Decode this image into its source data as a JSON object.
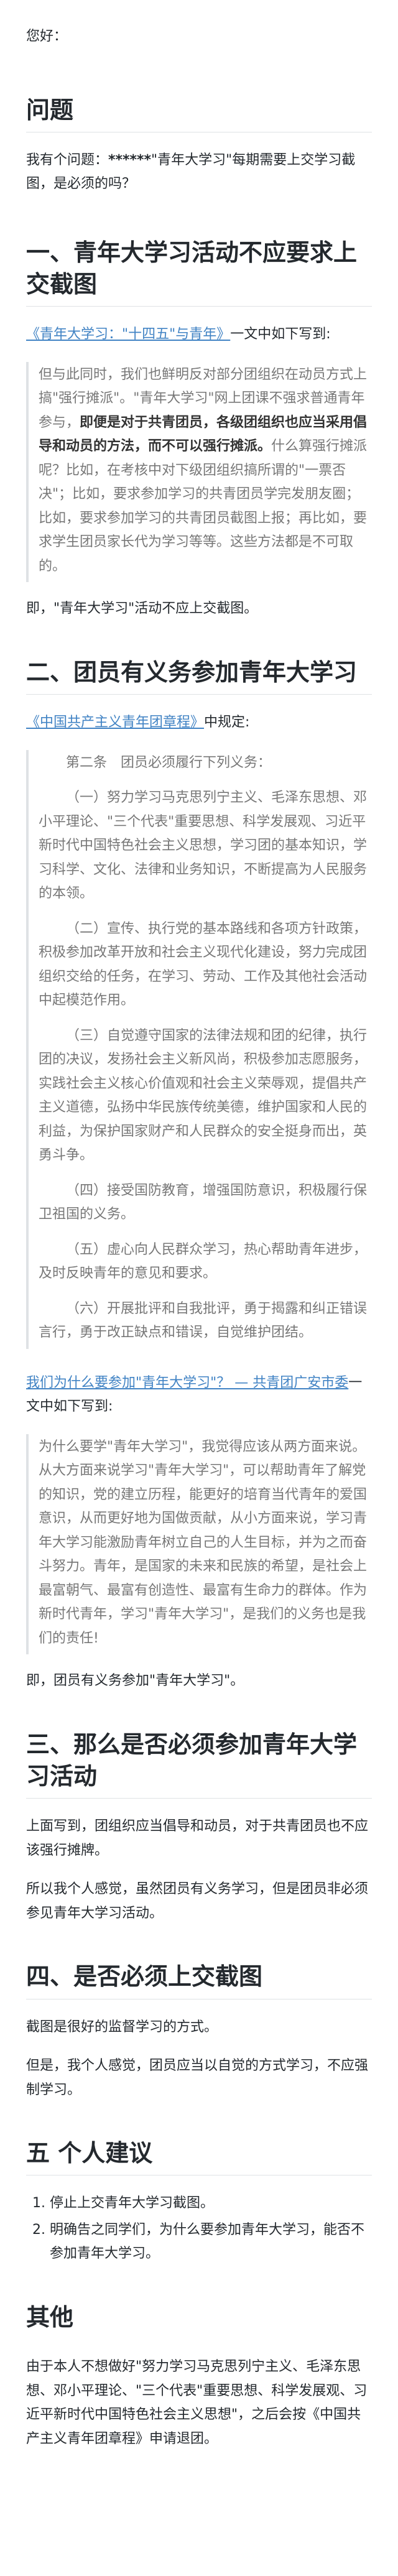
{
  "greeting": "您好：",
  "question": {
    "heading": "问题",
    "text_prefix": "我有个问题：",
    "text_bold": "******",
    "text_suffix": "\"青年大学习\"每期需要上交学习截图，是必须的吗？"
  },
  "s1": {
    "heading": "一、青年大学习活动不应要求上交截图",
    "link_text": "《青年大学习：\"十四五\"与青年》",
    "after_link": "一文中如下写到:",
    "quote_pre": "但与此同时，我们也鲜明反对部分团组织在动员方式上搞\"强行摊派\"。\"青年大学习\"网上团课不强求普通青年参与，",
    "quote_bold": "即便是对于共青团员，各级团组织也应当采用倡导和动员的方法，而不可以强行摊派。",
    "quote_post": "什么算强行摊派呢？比如，在考核中对下级团组织搞所谓的\"一票否决\"；比如，要求参加学习的共青团员学完发朋友圈；比如，要求参加学习的共青团员截图上报；再比如，要求学生团员家长代为学习等等。这些方法都是不可取的。",
    "conclusion": "即，\"青年大学习\"活动不应上交截图。"
  },
  "s2": {
    "heading": "二、团员有义务参加青年大学习",
    "link_text": "《中国共产主义青年团章程》",
    "after_link": "中规定:",
    "quote_title": "第二条　团员必须履行下列义务：",
    "items": [
      "（一）努力学习马克思列宁主义、毛泽东思想、邓小平理论、\"三个代表\"重要思想、科学发展观、习近平新时代中国特色社会主义思想，学习团的基本知识，学习科学、文化、法律和业务知识，不断提高为人民服务的本领。",
      "（二）宣传、执行党的基本路线和各项方针政策，积极参加改革开放和社会主义现代化建设，努力完成团组织交给的任务，在学习、劳动、工作及其他社会活动中起模范作用。",
      "（三）自觉遵守国家的法律法规和团的纪律，执行团的决议，发扬社会主义新风尚，积极参加志愿服务，实践社会主义核心价值观和社会主义荣辱观，提倡共产主义道德，弘扬中华民族传统美德，维护国家和人民的利益，为保护国家财产和人民群众的安全挺身而出，英勇斗争。",
      "（四）接受国防教育，增强国防意识，积极履行保卫祖国的义务。",
      "（五）虚心向人民群众学习，热心帮助青年进步，及时反映青年的意见和要求。",
      "（六）开展批评和自我批评，勇于揭露和纠正错误言行，勇于改正缺点和错误，自觉维护团结。"
    ],
    "link2_text": "我们为什么要参加\"青年大学习\"？ — 共青团广安市委",
    "after_link2": "一文中如下写到:",
    "quote2": "为什么要学\"青年大学习\"，我觉得应该从两方面来说。从大方面来说学习\"青年大学习\"，可以帮助青年了解党的知识，党的建立历程，能更好的培育当代青年的爱国意识，从而更好地为国做贡献，从小方面来说，学习青年大学习能激励青年树立自己的人生目标，并为之而奋斗努力。青年，是国家的未来和民族的希望，是社会上最富朝气、最富有创造性、最富有生命力的群体。作为新时代青年，学习\"青年大学习\"，是我们的义务也是我们的责任!",
    "conclusion": "即，团员有义务参加\"青年大学习\"。"
  },
  "s3": {
    "heading": "三、那么是否必须参加青年大学习活动",
    "p1": "上面写到，团组织应当倡导和动员，对于共青团员也不应该强行摊牌。",
    "p2": "所以我个人感觉，虽然团员有义务学习，但是团员非必须参见青年大学习活动。"
  },
  "s4": {
    "heading": "四、是否必须上交截图",
    "p1": "截图是很好的监督学习的方式。",
    "p2": "但是，我个人感觉，团员应当以自觉的方式学习，不应强制学习。"
  },
  "s5": {
    "heading": "五 个人建议",
    "items": [
      "停止上交青年大学习截图。",
      "明确告之同学们，为什么要参加青年大学习，能否不参加青年大学习。"
    ]
  },
  "s6": {
    "heading": "其他",
    "text": "由于本人不想做好\"努力学习马克思列宁主义、毛泽东思想、邓小平理论、\"三个代表\"重要思想、科学发展观、习近平新时代中国特色社会主义思想\"，之后会按《中国共产主义青年团章程》申请退团。"
  }
}
